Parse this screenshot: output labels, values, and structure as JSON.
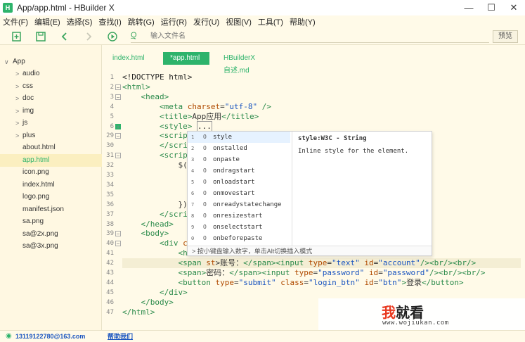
{
  "window": {
    "title": "App/app.html - HBuilder X",
    "minimize": "—",
    "maximize": "☐",
    "close": "✕"
  },
  "menu": [
    "文件(F)",
    "编辑(E)",
    "选择(S)",
    "查找(I)",
    "跳转(G)",
    "运行(R)",
    "发行(U)",
    "视图(V)",
    "工具(T)",
    "帮助(Y)"
  ],
  "toolbar": {
    "search_placeholder": "输入文件名",
    "preview_label": "预览"
  },
  "sidebar": {
    "items": [
      {
        "label": "App",
        "chevron": "∨",
        "level": 0
      },
      {
        "label": "audio",
        "chevron": ">",
        "level": 1
      },
      {
        "label": "css",
        "chevron": ">",
        "level": 1
      },
      {
        "label": "doc",
        "chevron": ">",
        "level": 1
      },
      {
        "label": "img",
        "chevron": ">",
        "level": 1
      },
      {
        "label": "js",
        "chevron": ">",
        "level": 1
      },
      {
        "label": "plus",
        "chevron": ">",
        "level": 1
      },
      {
        "label": "about.html",
        "chevron": "",
        "level": 1
      },
      {
        "label": "app.html",
        "chevron": "",
        "level": 1,
        "active": true
      },
      {
        "label": "icon.png",
        "chevron": "",
        "level": 1
      },
      {
        "label": "index.html",
        "chevron": "",
        "level": 1
      },
      {
        "label": "logo.png",
        "chevron": "",
        "level": 1
      },
      {
        "label": "manifest.json",
        "chevron": "",
        "level": 1
      },
      {
        "label": "sa.png",
        "chevron": "",
        "level": 1
      },
      {
        "label": "sa@2x.png",
        "chevron": "",
        "level": 1
      },
      {
        "label": "sa@3x.png",
        "chevron": "",
        "level": 1
      }
    ]
  },
  "tabs": [
    {
      "label": "index.html",
      "active": false
    },
    {
      "label": "*app.html",
      "active": true
    },
    {
      "label": "HBuilderX自述.md",
      "active": false
    }
  ],
  "editor": {
    "lines": [
      {
        "n": "1",
        "fold": "",
        "html": "<span class='tx'>&lt;!DOCTYPE html&gt;</span>"
      },
      {
        "n": "2",
        "fold": "⊟",
        "html": "<span class='tg'>&lt;html&gt;</span>"
      },
      {
        "n": "3",
        "fold": "⊟",
        "html": "    <span class='tg'>&lt;head&gt;</span>"
      },
      {
        "n": "4",
        "fold": "",
        "html": "        <span class='tg'>&lt;meta</span> <span class='at'>charset</span>=<span class='sv'>\"utf-8\"</span> <span class='tg'>/&gt;</span>"
      },
      {
        "n": "5",
        "fold": "",
        "html": "        <span class='tg'>&lt;title&gt;</span>App应用<span class='tg'>&lt;/title&gt;</span>"
      },
      {
        "n": "6",
        "fold": "green",
        "html": "        <span class='tg'>&lt;style&gt;</span> <span class='tx' style='border:1px solid #999'>...</span>"
      },
      {
        "n": "29",
        "fold": "⊟",
        "html": "        <span class='tg'>&lt;scrip</span>                                          <span class='sv'>in.js\"&gt;</span>"
      },
      {
        "n": "30",
        "fold": "",
        "html": "        <span class='tg'>&lt;/scrip</span>"
      },
      {
        "n": "31",
        "fold": "⊟",
        "html": "        <span class='tg'>&lt;scrip</span>"
      },
      {
        "n": "32",
        "fold": "",
        "html": "            $(d"
      },
      {
        "n": "33",
        "fold": "",
        "html": "              $"
      },
      {
        "n": "34",
        "fold": "",
        "html": ""
      },
      {
        "n": "35",
        "fold": "",
        "html": "              }"
      },
      {
        "n": "36",
        "fold": "",
        "html": "            })"
      },
      {
        "n": "37",
        "fold": "",
        "html": "        <span class='tg'>&lt;/scrip</span>"
      },
      {
        "n": "38",
        "fold": "",
        "html": "    <span class='tg'>&lt;/head&gt;</span>"
      },
      {
        "n": "39",
        "fold": "⊟",
        "html": "    <span class='tg'>&lt;body&gt;</span>"
      },
      {
        "n": "40",
        "fold": "⊟",
        "html": "        <span class='tg'>&lt;div</span> <span class='at'>cl</span>"
      },
      {
        "n": "41",
        "fold": "",
        "html": "            <span class='tg'>&lt;h</span>"
      },
      {
        "n": "42",
        "fold": "",
        "html": "            <span class='tg'>&lt;span</span> <span class='at'>st</span>&gt;账号：<span class='tg'>&lt;/span&gt;&lt;input</span> <span class='at'>type</span>=<span class='sv'>\"text\"</span> <span class='at'>id</span>=<span class='sv'>\"account\"</span><span class='tg'>/&gt;&lt;br/&gt;&lt;br/&gt;</span>"
      },
      {
        "n": "43",
        "fold": "",
        "html": "            <span class='tg'>&lt;span&gt;</span>密码：<span class='tg'>&lt;/span&gt;&lt;input</span> <span class='at'>type</span>=<span class='sv'>\"password\"</span> <span class='at'>id</span>=<span class='sv'>\"password\"</span><span class='tg'>/&gt;&lt;br/&gt;&lt;br/&gt;</span>"
      },
      {
        "n": "44",
        "fold": "",
        "html": "            <span class='tg'>&lt;button</span> <span class='at'>type</span>=<span class='sv'>\"submit\"</span> <span class='at'>class</span>=<span class='sv'>\"login_btn\"</span> <span class='at'>id</span>=<span class='sv'>\"btn\"</span><span class='tg'>&gt;</span>登录<span class='tg'>&lt;/button&gt;</span>"
      },
      {
        "n": "45",
        "fold": "",
        "html": "        <span class='tg'>&lt;/div&gt;</span>"
      },
      {
        "n": "46",
        "fold": "",
        "html": "    <span class='tg'>&lt;/body&gt;</span>"
      },
      {
        "n": "47",
        "fold": "",
        "html": "<span class='tg'>&lt;/html&gt;</span>"
      }
    ]
  },
  "autocomplete": {
    "items": [
      {
        "idx": "1",
        "icon": "O",
        "name": "style"
      },
      {
        "idx": "2",
        "icon": "O",
        "name": "onstalled"
      },
      {
        "idx": "3",
        "icon": "O",
        "name": "onpaste"
      },
      {
        "idx": "4",
        "icon": "O",
        "name": "ondragstart"
      },
      {
        "idx": "5",
        "icon": "O",
        "name": "onloadstart"
      },
      {
        "idx": "6",
        "icon": "O",
        "name": "onmovestart"
      },
      {
        "idx": "7",
        "icon": "O",
        "name": "onreadystatechange"
      },
      {
        "idx": "8",
        "icon": "O",
        "name": "onresizestart"
      },
      {
        "idx": "9",
        "icon": "O",
        "name": "onselectstart"
      },
      {
        "idx": "0",
        "icon": "O",
        "name": "onbeforepaste"
      }
    ],
    "detail_title": "style:W3C - String",
    "detail_text": "Inline style for the element.",
    "footer": "按小键盘输入数字，单击Alt切换插入模式"
  },
  "status": {
    "account": "13119122780@163.com",
    "help_link": "帮助我们"
  },
  "watermark": {
    "title_red": "我",
    "title_rest": "就看",
    "url": "www.wojiukan.com"
  },
  "colors": {
    "accent": "#2db36b",
    "background": "#fffae8"
  }
}
